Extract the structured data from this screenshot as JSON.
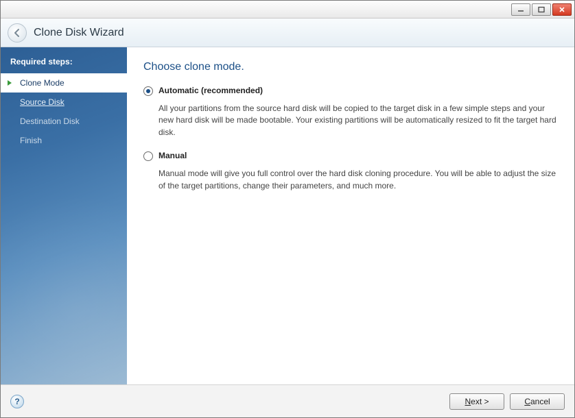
{
  "window": {
    "title": "Clone Disk Wizard"
  },
  "sidebar": {
    "header": "Required steps:",
    "steps": [
      {
        "label": "Clone Mode",
        "state": "active"
      },
      {
        "label": "Source Disk",
        "state": "link"
      },
      {
        "label": "Destination Disk",
        "state": "pending"
      },
      {
        "label": "Finish",
        "state": "pending"
      }
    ]
  },
  "main": {
    "title": "Choose clone mode.",
    "options": [
      {
        "label": "Automatic (recommended)",
        "description": "All your partitions from the source hard disk will be copied to the target disk in a few simple steps and your new hard disk will be made bootable. Your existing partitions will be automatically resized to fit the target hard disk.",
        "selected": true
      },
      {
        "label": "Manual",
        "description": "Manual mode will give you full control over the hard disk cloning procedure. You will be able to adjust the size of the target partitions, change their parameters, and much more.",
        "selected": false
      }
    ]
  },
  "footer": {
    "next": "Next >",
    "cancel": "Cancel",
    "help_char": "?"
  }
}
